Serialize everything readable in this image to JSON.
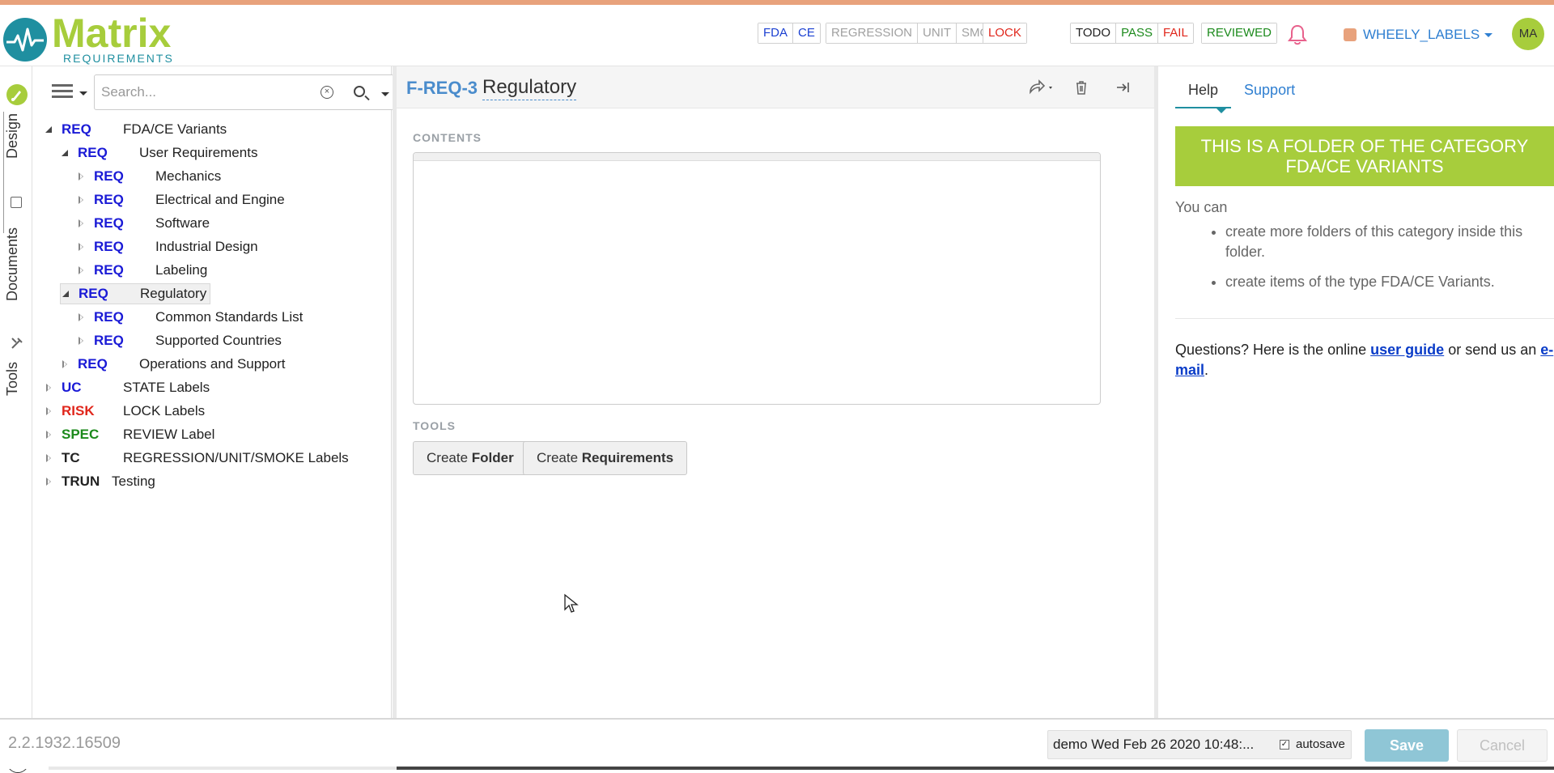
{
  "brand": {
    "name": "Matrix",
    "sub": "REQUIREMENTS"
  },
  "header": {
    "label_groups": [
      {
        "labels": [
          {
            "text": "FDA",
            "color": "#1a3fd1"
          },
          {
            "text": "CE",
            "color": "#1a3fd1"
          }
        ]
      },
      {
        "labels": [
          {
            "text": "REGRESSION",
            "color": "#a0a0a0"
          },
          {
            "text": "UNIT",
            "color": "#a0a0a0"
          },
          {
            "text": "SMOKE",
            "color": "#a0a0a0"
          }
        ]
      },
      {
        "labels": [
          {
            "text": "LOCK",
            "color": "#e0261b"
          }
        ]
      },
      {
        "labels": [
          {
            "text": "TODO",
            "color": "#222222"
          },
          {
            "text": "PASS",
            "color": "#1c8a1c"
          },
          {
            "text": "FAIL",
            "color": "#e0261b"
          }
        ]
      },
      {
        "labels": [
          {
            "text": "REVIEWED",
            "color": "#1c8a1c"
          }
        ]
      }
    ],
    "project": "WHEELY_LABELS",
    "avatar": "MA"
  },
  "vtabs": {
    "design": "Design",
    "documents": "Documents",
    "tools": "Tools",
    "help": "?"
  },
  "search": {
    "placeholder": "Search..."
  },
  "tree": [
    {
      "cat": "REQ",
      "cat_color": "#1a1ad6",
      "name": "FDA/CE Variants",
      "level": 0,
      "state": "open"
    },
    {
      "cat": "REQ",
      "cat_color": "#1a1ad6",
      "name": "User Requirements",
      "level": 1,
      "state": "open"
    },
    {
      "cat": "REQ",
      "cat_color": "#1a1ad6",
      "name": "Mechanics",
      "level": 2,
      "state": "closed"
    },
    {
      "cat": "REQ",
      "cat_color": "#1a1ad6",
      "name": "Electrical and Engine",
      "level": 2,
      "state": "closed"
    },
    {
      "cat": "REQ",
      "cat_color": "#1a1ad6",
      "name": "Software",
      "level": 2,
      "state": "closed"
    },
    {
      "cat": "REQ",
      "cat_color": "#1a1ad6",
      "name": "Industrial Design",
      "level": 2,
      "state": "closed"
    },
    {
      "cat": "REQ",
      "cat_color": "#1a1ad6",
      "name": "Labeling",
      "level": 2,
      "state": "closed"
    },
    {
      "cat": "REQ",
      "cat_color": "#1a1ad6",
      "name": "Regulatory",
      "level": 1,
      "state": "open",
      "selected": true
    },
    {
      "cat": "REQ",
      "cat_color": "#1a1ad6",
      "name": "Common Standards List",
      "level": 2,
      "state": "closed"
    },
    {
      "cat": "REQ",
      "cat_color": "#1a1ad6",
      "name": "Supported Countries",
      "level": 2,
      "state": "closed"
    },
    {
      "cat": "REQ",
      "cat_color": "#1a1ad6",
      "name": "Operations and Support",
      "level": 1,
      "state": "closed"
    },
    {
      "cat": "UC",
      "cat_color": "#1a1ad6",
      "name": "STATE Labels",
      "level": 0,
      "state": "closed"
    },
    {
      "cat": "RISK",
      "cat_color": "#e0261b",
      "name": "LOCK Labels",
      "level": 0,
      "state": "closed"
    },
    {
      "cat": "SPEC",
      "cat_color": "#1c8a1c",
      "name": "REVIEW Label",
      "level": 0,
      "state": "closed"
    },
    {
      "cat": "TC",
      "cat_color": "#222222",
      "name": "REGRESSION/UNIT/SMOKE Labels",
      "level": 0,
      "state": "closed"
    },
    {
      "cat": "TRUN",
      "cat_color": "#222222",
      "name": "Testing",
      "level": 0,
      "state": "closed"
    }
  ],
  "item": {
    "id": "F-REQ-3",
    "title": "Regulatory",
    "contents_label": "CONTENTS",
    "tools_label": "TOOLS",
    "create_folder_prefix": "Create",
    "create_folder_bold": "Folder",
    "create_req_prefix": "Create",
    "create_req_bold": "Requirements"
  },
  "help": {
    "tab_help": "Help",
    "tab_support": "Support",
    "banner": "THIS IS A FOLDER OF THE CATEGORY FDA/CE VARIANTS",
    "you_can": "You can",
    "bullet1": "create more folders of this category inside this folder.",
    "bullet2": "create items of the type FDA/CE Variants.",
    "q_prefix": "Questions? Here is the online",
    "q_link1": "user guide",
    "q_middle": "or send us an",
    "q_link2": "e-mail",
    "q_suffix": "."
  },
  "footer": {
    "version": "2.2.1932.16509",
    "save_status": "demo Wed Feb 26 2020 10:48:...",
    "autosave": "autosave",
    "save": "Save",
    "cancel": "Cancel"
  },
  "colors": {
    "accent": "#a7cd3c",
    "brand_teal": "#1f8fa0",
    "link": "#2f7fd1"
  }
}
